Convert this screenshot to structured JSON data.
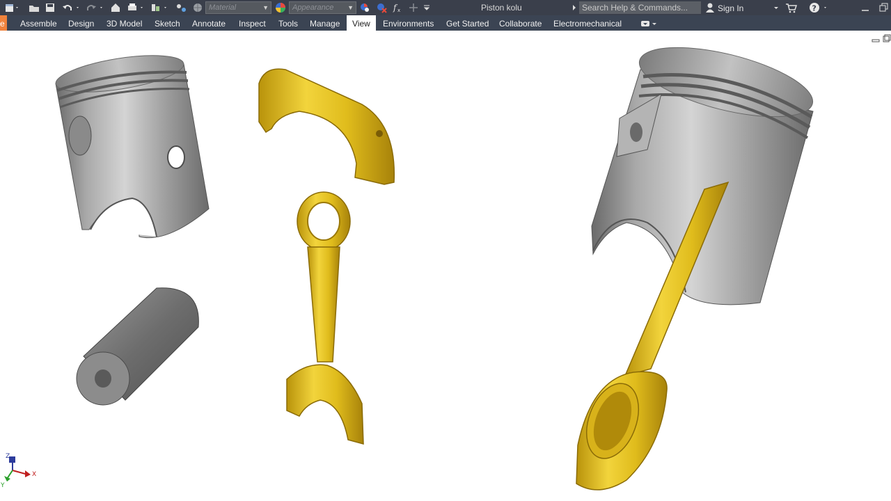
{
  "qat": {
    "material_placeholder": "Material",
    "appearance_placeholder": "Appearance",
    "document_title": "Piston kolu",
    "search_placeholder": "Search Help & Commands...",
    "sign_in_label": "Sign In"
  },
  "ribbon": {
    "tabs": [
      {
        "label": "e"
      },
      {
        "label": "Assemble"
      },
      {
        "label": "Design"
      },
      {
        "label": "3D Model"
      },
      {
        "label": "Sketch"
      },
      {
        "label": "Annotate"
      },
      {
        "label": "Inspect"
      },
      {
        "label": "Tools"
      },
      {
        "label": "Manage"
      },
      {
        "label": "View"
      },
      {
        "label": "Environments"
      },
      {
        "label": "Get Started"
      },
      {
        "label": "Collaborate"
      },
      {
        "label": "Electromechanical"
      }
    ],
    "active_tab": "View"
  },
  "viewcube": {
    "axis_z": "Z",
    "axis_x": "X",
    "axis_y": "Y"
  },
  "colors": {
    "title_bar": "#3a3f4b",
    "ribbon_bar": "#3b4453",
    "file_tab": "#f0823c",
    "steel": "#9a9a9a",
    "brass": "#e3c11d"
  },
  "icons": [
    "new-file-icon",
    "open-icon",
    "save-icon",
    "undo-icon",
    "redo-icon",
    "home-icon",
    "print-icon",
    "appearance-color-icon",
    "search-icon",
    "user-icon",
    "cart-icon",
    "help-icon",
    "minimize-icon",
    "restore-icon"
  ]
}
